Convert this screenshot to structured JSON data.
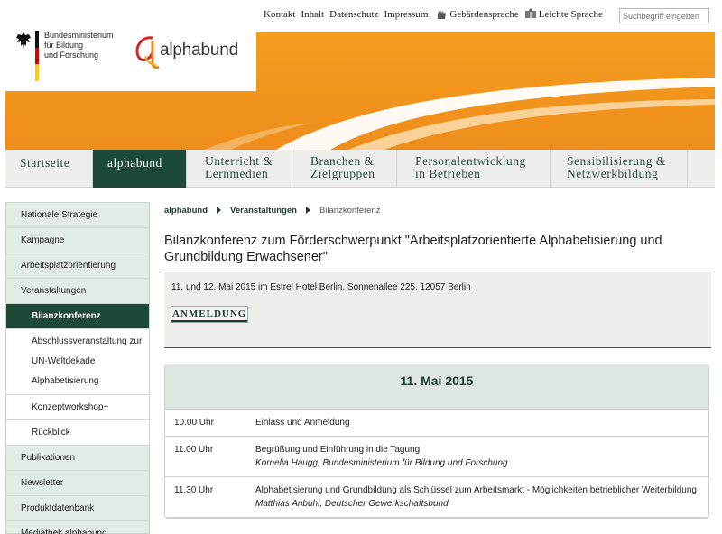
{
  "topnav": {
    "links": [
      "Kontakt",
      "Inhalt",
      "Datenschutz",
      "Impressum"
    ],
    "sign_language": "Gebärdensprache",
    "easy_language": "Leichte Sprache",
    "search_placeholder": "Suchbegriff eingeben"
  },
  "logos": {
    "bmbf_line1": "Bundesministerium",
    "bmbf_line2": "für Bildung",
    "bmbf_line3": "und Forschung",
    "alphabund": "alphabund"
  },
  "colors": {
    "banner_orange": "#f39a1f",
    "nav_active": "#1d4a38",
    "sidebar_bg": "#e3ebe6",
    "header_green": "#dde6e1"
  },
  "mainnav": [
    {
      "line1": "Startseite",
      "line2": "",
      "active": false
    },
    {
      "line1": "alphabund",
      "line2": "",
      "active": true
    },
    {
      "line1": "Unterricht &",
      "line2": "Lernmedien",
      "active": false
    },
    {
      "line1": "Branchen &",
      "line2": "Zielgruppen",
      "active": false
    },
    {
      "line1": "Personalentwicklung",
      "line2": "in Betrieben",
      "active": false
    },
    {
      "line1": "Sensibilisierung &",
      "line2": "Netzwerkbildung",
      "active": false
    }
  ],
  "sidebar": {
    "items": [
      "Nationale Strategie",
      "Kampagne",
      "Arbeitsplatzorientierung",
      "Veranstaltungen"
    ],
    "active": "Bilanzkonferenz",
    "sub_multi": [
      "Abschlussveranstaltung zur",
      "UN-Weltdekade",
      "Alphabetisierung"
    ],
    "sub_single": [
      "Konzeptworkshop+",
      "Rückblick"
    ],
    "items_after": [
      "Publikationen",
      "Newsletter",
      "Produktdatenbank",
      "Mediathek alphabund"
    ]
  },
  "breadcrumb": {
    "c1": "alphabund",
    "c2": "Veranstaltungen",
    "c3": "Bilanzkonferenz"
  },
  "page": {
    "title_line1": "Bilanzkonferenz zum Förderschwerpunkt \"Arbeitsplatzorientierte Alphabetisierung und",
    "title_line2": "Grundbildung Erwachsener\"",
    "event_info": "11. und 12. Mai 2015 im Estrel Hotel Berlin, Sonnenallee 225, 12057 Berlin",
    "register_label": "ANMELDUNG"
  },
  "program": {
    "day": "11. Mai 2015",
    "rows": [
      {
        "time": "10.00 Uhr",
        "title": "Einlass und Anmeldung",
        "speaker": ""
      },
      {
        "time": "11.00 Uhr",
        "title": "Begrüßung und Einführung in die Tagung",
        "speaker": "Kornelia Haugg, Bundesministerium für Bildung und Forschung"
      },
      {
        "time": "11.30 Uhr",
        "title": "Alphabetisierung und Grundbildung als Schlüssel zum Arbeitsmarkt - Möglichkeiten betrieblicher Weiterbildung",
        "speaker": "Matthias Anbuhl, Deutscher Gewerkschaftsbund"
      }
    ]
  }
}
